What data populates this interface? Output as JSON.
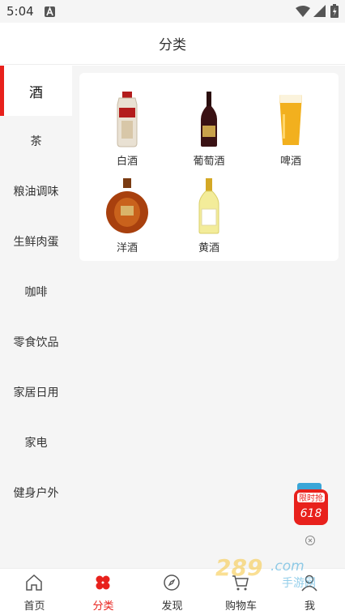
{
  "status_bar": {
    "time": "5:04"
  },
  "header": {
    "title": "分类"
  },
  "sidebar": {
    "items": [
      {
        "label": "酒"
      },
      {
        "label": "茶"
      },
      {
        "label": "粮油调味"
      },
      {
        "label": "生鲜肉蛋"
      },
      {
        "label": "咖啡"
      },
      {
        "label": "零食饮品"
      },
      {
        "label": "家居日用"
      },
      {
        "label": "家电"
      },
      {
        "label": "健身户外"
      }
    ],
    "active_index": 0
  },
  "categories": [
    {
      "label": "白酒",
      "icon": "baijiu-bottle-icon"
    },
    {
      "label": "葡萄酒",
      "icon": "wine-bottle-icon"
    },
    {
      "label": "啤酒",
      "icon": "beer-glass-icon"
    },
    {
      "label": "洋酒",
      "icon": "cognac-bottle-icon"
    },
    {
      "label": "黄酒",
      "icon": "yellow-wine-bottle-icon"
    }
  ],
  "promo_badge": {
    "line1": "限时抢",
    "line2": "618"
  },
  "watermark": {
    "text": "289.com",
    "sub": "手游网"
  },
  "tabbar": {
    "tabs": [
      {
        "label": "首页"
      },
      {
        "label": "分类"
      },
      {
        "label": "发现"
      },
      {
        "label": "购物车"
      },
      {
        "label": "我"
      }
    ],
    "active_index": 1
  },
  "colors": {
    "accent": "#e8211c",
    "background": "#f5f5f5"
  }
}
